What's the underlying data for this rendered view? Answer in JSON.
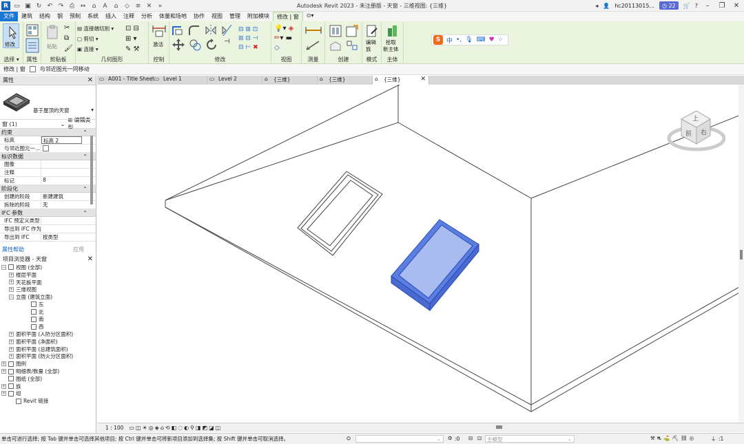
{
  "window": {
    "title": "Autodesk Revit 2023 - 未注册版 - 天窗 - 三维视图: {三维}",
    "user": "hc20113015...",
    "notification_count": "22"
  },
  "ribbon_tabs": [
    "文件",
    "建筑",
    "结构",
    "钢",
    "预制",
    "系统",
    "插入",
    "注释",
    "分析",
    "体量和场地",
    "协作",
    "视图",
    "管理",
    "附加模块",
    "修改 | 窗"
  ],
  "ribbon": {
    "modify_label": "修改",
    "select_label": "选择 ▾",
    "properties_label": "属性",
    "clipboard_label": "剪贴板",
    "paste_label": "粘贴",
    "geometry_label": "几何图形",
    "join_cut_label": "连接端切割",
    "cut_label": "剪切",
    "join_label": "连接",
    "control_label": "控制",
    "activate_label": "激活",
    "modify_panel_label": "修改",
    "view_label": "视图",
    "measure_label": "测量",
    "create_label": "创建",
    "mode_label": "模式",
    "edit_family_label": "编辑\n族",
    "pick_host_label": "拾取\n新主体",
    "host_label": "主体",
    "ime_chars": "中"
  },
  "options_bar": {
    "context": "修改 | 窗",
    "move_with_nearby": "与邻近图元一同移动"
  },
  "properties": {
    "title": "属性",
    "type_name": "基于屋顶的天窗",
    "instance_filter": "窗 (1)",
    "edit_type": "编辑类型",
    "groups": [
      {
        "name": "约束",
        "rows": [
          {
            "k": "标高",
            "v": "标高 2"
          },
          {
            "k": "与邻近图元一...",
            "v": ""
          }
        ]
      },
      {
        "name": "标识数据",
        "rows": [
          {
            "k": "图像",
            "v": ""
          },
          {
            "k": "注释",
            "v": ""
          },
          {
            "k": "标记",
            "v": "8"
          }
        ]
      },
      {
        "name": "阶段化",
        "rows": [
          {
            "k": "创建的阶段",
            "v": "新建建筑"
          },
          {
            "k": "拆除的阶段",
            "v": "无"
          }
        ]
      },
      {
        "name": "IFC 参数",
        "rows": [
          {
            "k": "IFC 预定义类型",
            "v": ""
          },
          {
            "k": "导出到 IFC 作为",
            "v": ""
          },
          {
            "k": "导出到 IFC",
            "v": "按类型"
          }
        ]
      }
    ],
    "help_link": "属性帮助",
    "apply_button": "应用"
  },
  "browser": {
    "title": "项目浏览器 - 天窗",
    "nodes": [
      {
        "label": "视图 (全部)",
        "indent": 0,
        "exp": "−",
        "icon": true
      },
      {
        "label": "楼层平面",
        "indent": 1,
        "exp": "+",
        "icon": false
      },
      {
        "label": "天花板平面",
        "indent": 1,
        "exp": "+",
        "icon": false
      },
      {
        "label": "三维视图",
        "indent": 1,
        "exp": "+",
        "icon": false
      },
      {
        "label": "立面 (建筑立面)",
        "indent": 1,
        "exp": "−",
        "icon": false
      },
      {
        "label": "东",
        "indent": 3,
        "exp": "",
        "icon": true
      },
      {
        "label": "北",
        "indent": 3,
        "exp": "",
        "icon": true
      },
      {
        "label": "南",
        "indent": 3,
        "exp": "",
        "icon": true
      },
      {
        "label": "西",
        "indent": 3,
        "exp": "",
        "icon": true
      },
      {
        "label": "面积平面 (人防分区面积)",
        "indent": 1,
        "exp": "+",
        "icon": false
      },
      {
        "label": "面积平面 (净面积)",
        "indent": 1,
        "exp": "+",
        "icon": false
      },
      {
        "label": "面积平面 (总建筑面积)",
        "indent": 1,
        "exp": "+",
        "icon": false
      },
      {
        "label": "面积平面 (防火分区面积)",
        "indent": 1,
        "exp": "+",
        "icon": false
      },
      {
        "label": "图例",
        "indent": 0,
        "exp": "+",
        "icon": true
      },
      {
        "label": "明细表/数量 (全部)",
        "indent": 0,
        "exp": "+",
        "icon": true
      },
      {
        "label": "图纸 (全部)",
        "indent": 0,
        "exp": "",
        "icon": true
      },
      {
        "label": "族",
        "indent": 0,
        "exp": "+",
        "icon": true
      },
      {
        "label": "组",
        "indent": 0,
        "exp": "+",
        "icon": true
      },
      {
        "label": "Revit 链接",
        "indent": 1,
        "exp": "",
        "icon": true
      }
    ]
  },
  "view_tabs": [
    {
      "label": "A001 - Title Sheet",
      "active": false
    },
    {
      "label": "Level 1",
      "active": false
    },
    {
      "label": "Level 2",
      "active": false
    },
    {
      "label": "{三维}",
      "active": false
    },
    {
      "label": "{三维}",
      "active": false
    },
    {
      "label": "{三维}",
      "active": true
    }
  ],
  "viewcube": {
    "top": "上",
    "front": "前",
    "right": "右"
  },
  "view_control": {
    "scale": "1 : 100"
  },
  "status": {
    "message": "单击可进行选择; 按 Tab 键并单击可选择其他项目; 按 Ctrl 键并单击可将新项目添加到选择集; 按 Shift 键并单击可取消选择。",
    "zero": ":0",
    "model": "主模型",
    "filter_count": ":1"
  },
  "colors": {
    "selection": "#5b7fe0",
    "file_tab": "#1976d2",
    "ribbon_bg": "#eaf4de"
  }
}
